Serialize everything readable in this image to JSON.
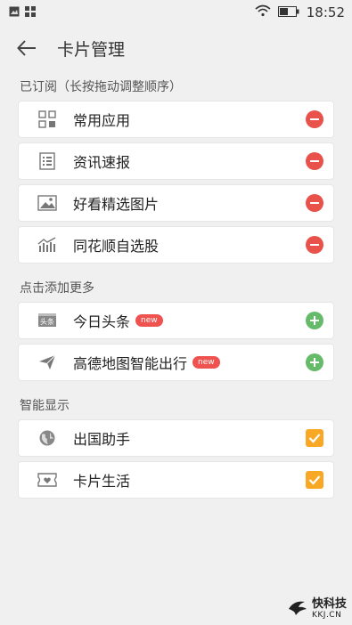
{
  "status_bar": {
    "time": "18:52"
  },
  "header": {
    "title": "卡片管理"
  },
  "sections": {
    "subscribed": {
      "title": "已订阅（长按拖动调整顺序）",
      "items": [
        {
          "label": "常用应用",
          "icon": "app-grid-icon"
        },
        {
          "label": "资讯速报",
          "icon": "news-list-icon"
        },
        {
          "label": "好看精选图片",
          "icon": "picture-icon"
        },
        {
          "label": "同花顺自选股",
          "icon": "stock-chart-icon"
        }
      ]
    },
    "add_more": {
      "title": "点击添加更多",
      "items": [
        {
          "label": "今日头条",
          "icon": "toutiao-icon",
          "badge": "new"
        },
        {
          "label": "高德地图智能出行",
          "icon": "navigation-icon",
          "badge": "new"
        }
      ]
    },
    "smart_display": {
      "title": "智能显示",
      "items": [
        {
          "label": "出国助手",
          "icon": "globe-icon",
          "checked": true
        },
        {
          "label": "卡片生活",
          "icon": "ticket-icon",
          "checked": true
        }
      ]
    }
  },
  "watermark": {
    "title": "快科技",
    "domain": "KKJ.CN"
  },
  "colors": {
    "remove": "#e9524a",
    "add": "#66bb6a",
    "check": "#f9a825",
    "badge": "#ef5350",
    "background": "#f0f0f0"
  }
}
